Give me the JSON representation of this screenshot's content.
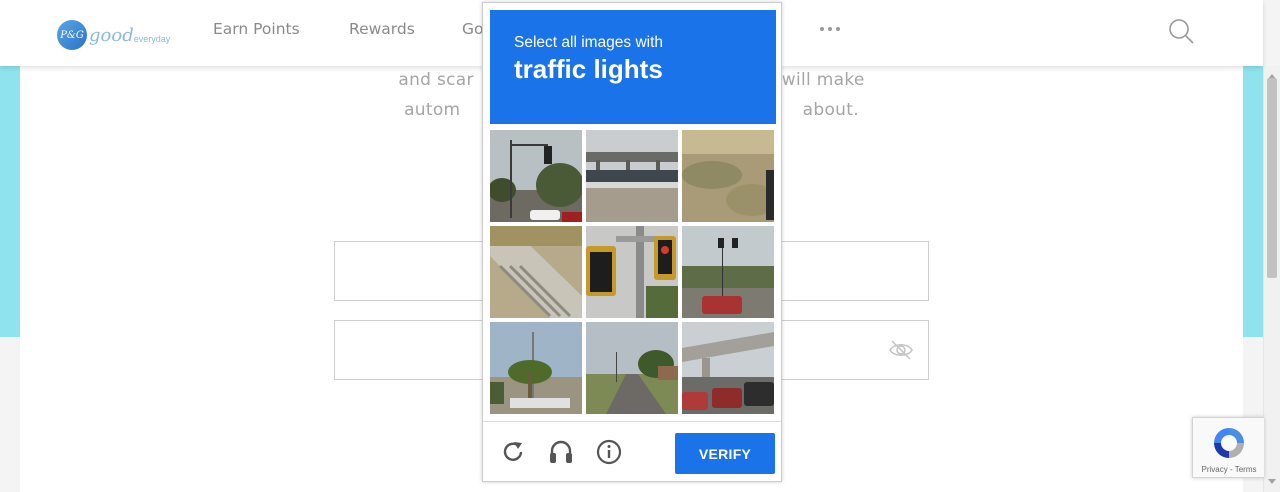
{
  "page": {
    "paragraph_line1": "and scar                                                      will make",
    "paragraph_line2": "autom                                                            about."
  },
  "header": {
    "logo_badge": "P&G",
    "logo_good": "good",
    "logo_everyday": "everyday",
    "nav": [
      {
        "label": "Earn Points"
      },
      {
        "label": "Rewards"
      },
      {
        "label": "Go"
      }
    ],
    "more_icon": "more-dots-icon",
    "search_icon": "search-icon"
  },
  "form": {
    "email_value": "",
    "password_value": "",
    "password_toggle_icon": "eye-slash-icon"
  },
  "captcha": {
    "instruction": "Select all images with",
    "target": "traffic lights",
    "accent": "#1a73e8",
    "tiles": [
      {
        "desc": "street with traffic light and tree"
      },
      {
        "desc": "highway bridge"
      },
      {
        "desc": "sandy dune"
      },
      {
        "desc": "concrete drain and grass"
      },
      {
        "desc": "close-up traffic lights on pole"
      },
      {
        "desc": "road with traffic lights and red car"
      },
      {
        "desc": "palm tree and streetlight"
      },
      {
        "desc": "rural road"
      },
      {
        "desc": "overpass with parked cars"
      }
    ],
    "controls": {
      "reload_icon": "reload-icon",
      "audio_icon": "headphones-icon",
      "info_icon": "info-icon"
    },
    "verify_label": "VERIFY"
  },
  "recaptcha_badge": {
    "links": "Privacy - Terms",
    "logo_icon": "recaptcha-logo-icon"
  }
}
